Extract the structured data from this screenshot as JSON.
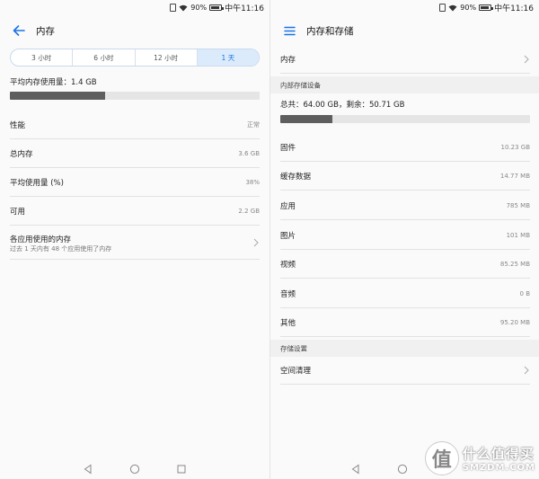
{
  "status": {
    "battery": "90%",
    "time": "中午11:16"
  },
  "left": {
    "title": "内存",
    "segments": [
      {
        "label": "3 小时"
      },
      {
        "label": "6 小时"
      },
      {
        "label": "12 小时"
      },
      {
        "label": "1 天"
      }
    ],
    "active_segment": "1 天",
    "avg_usage_label": "平均内存使用量：1.4 GB",
    "usage_fraction": 0.38,
    "rows": [
      {
        "label": "性能",
        "value": "正常"
      },
      {
        "label": "总内存",
        "value": "3.6 GB"
      },
      {
        "label": "平均使用量 (%)",
        "value": "38%"
      },
      {
        "label": "可用",
        "value": "2.2 GB"
      }
    ],
    "apps_row": {
      "label": "各应用使用的内存",
      "sub": "过去 1 天内有 48 个应用使用了内存"
    }
  },
  "right": {
    "title": "内存和存储",
    "memory_row": "内存",
    "section_internal": "内部存储设备",
    "storage_summary": "总共：64.00 GB，剩余：50.71 GB",
    "storage_fraction": 0.21,
    "rows": [
      {
        "label": "固件",
        "value": "10.23 GB"
      },
      {
        "label": "缓存数据",
        "value": "14.77 MB"
      },
      {
        "label": "应用",
        "value": "785 MB"
      },
      {
        "label": "图片",
        "value": "101 MB"
      },
      {
        "label": "视频",
        "value": "85.25 MB"
      },
      {
        "label": "音频",
        "value": "0 B"
      },
      {
        "label": "其他",
        "value": "95.20 MB"
      }
    ],
    "section_settings": "存储设置",
    "cleanup_row": "空间清理"
  },
  "watermark": {
    "cn": "什么值得买",
    "en": "SMZDM.COM",
    "badge": "值"
  },
  "colors": {
    "accent": "#1a73e8",
    "progress_fill": "#5e5e5e",
    "progress_track": "#e5e5e5"
  }
}
